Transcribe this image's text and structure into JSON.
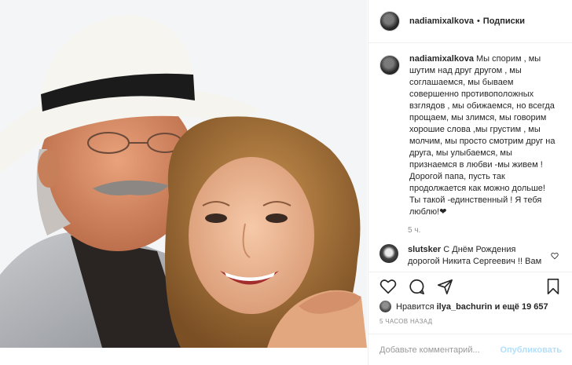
{
  "post": {
    "username": "nadiamixalkova",
    "separator": "•",
    "follow_label": "Подписки",
    "caption_text": "Мы спорим , мы шутим над друг другом , мы соглашаемся, мы бываем совершенно противоположных взглядов , мы обижаемся, но всегда прощаем, мы злимся, мы говорим хорошие слова ,мы грустим , мы молчим, мы просто смотрим друг на друга, мы улыбаемся, мы признаемся в любви -мы живем ! Дорогой папа, пусть так продолжается как можно дольше! Ты такой -единственный ! Я тебя люблю!❤",
    "caption_time": "5 ч."
  },
  "comment": {
    "username": "slutsker",
    "text": "С Днём Рождения дорогой Никита Сергеевич !! Вам здоровья, а нам ,ваших"
  },
  "icons": {
    "like": "heart-icon",
    "comment": "comment-icon",
    "share": "share-icon",
    "save": "bookmark-icon"
  },
  "likes": {
    "prefix": "Нравится",
    "user": "ilya_bachurin",
    "suffix": "и ещё 19 657"
  },
  "post_time": "5 ЧАСОВ НАЗАД",
  "add_comment": {
    "placeholder": "Добавьте комментарий...",
    "publish_label": "Опубликовать"
  },
  "colors": {
    "text": "#262626",
    "muted": "#8e8e8e",
    "publish_disabled": "#b2dffc",
    "border": "#efefef"
  }
}
